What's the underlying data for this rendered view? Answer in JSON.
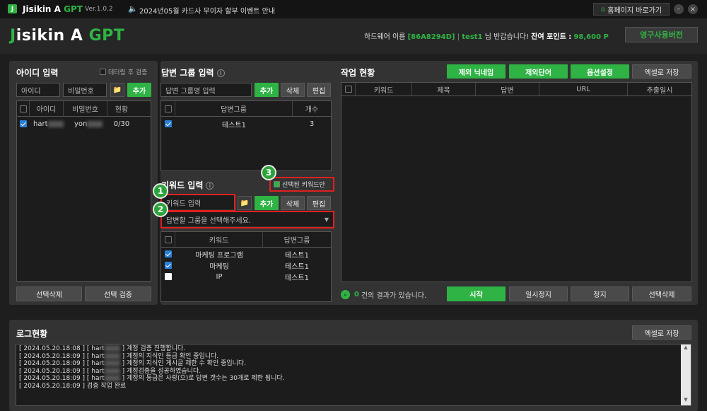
{
  "titlebar": {
    "app_name": "Jisikin A",
    "app_gpt": "GPT",
    "version": "Ver.1.0.2",
    "notice": "2024년05월 카드사 무이자 할부 이벤트 안내",
    "homepage_btn": "홈페이지 바로가기",
    "minimize": "–",
    "close": "×"
  },
  "header": {
    "logo_j": "J",
    "logo_rest": "isikin A",
    "logo_gpt": "GPT",
    "hw_label": "하드웨어 이름",
    "hw_id": "[86A8294D]",
    "user": "test1",
    "greeting": "님 반갑습니다!",
    "points_label": "잔여 포인트 :",
    "points_value": "98,600 P",
    "license_btn": "영구사용버전"
  },
  "id_panel": {
    "title": "아이디 입력",
    "after_verify_label": "데터링 후 검증",
    "id_placeholder": "아이디",
    "pw_placeholder": "비밀번호",
    "add_btn": "추가",
    "columns": [
      "",
      "아이디",
      "비밀번호",
      "현황"
    ],
    "rows": [
      {
        "checked": true,
        "id": "hart",
        "pw": "yon",
        "status": "0/30"
      }
    ],
    "delete_btn": "선택삭제",
    "verify_btn": "선택 검증"
  },
  "group_panel": {
    "title": "답변 그룹 입력",
    "input_placeholder": "답변 그룹명 입력",
    "add_btn": "추가",
    "delete_btn": "삭제",
    "edit_btn": "편집",
    "columns": [
      "",
      "답변그룹",
      "개수"
    ],
    "rows": [
      {
        "checked": true,
        "group": "테스트1",
        "count": "3"
      }
    ]
  },
  "keyword_panel": {
    "title": "키워드 입력",
    "only_selected_label": "선택된 키워드만",
    "input_placeholder": "키워드 입력",
    "add_btn": "추가",
    "delete_btn": "삭제",
    "edit_btn": "편집",
    "select_placeholder": "답변할 그룹을 선택해주세요.",
    "columns": [
      "",
      "키워드",
      "답변그룹"
    ],
    "rows": [
      {
        "checked": true,
        "keyword": "마케팅 프로그램",
        "group": "테스트1"
      },
      {
        "checked": true,
        "keyword": "마케팅",
        "group": "테스트1"
      },
      {
        "checked": false,
        "keyword": "IP",
        "group": "테스트1"
      }
    ]
  },
  "badges": {
    "b1": "1",
    "b2": "2",
    "b3": "3"
  },
  "work_panel": {
    "title": "작업 현황",
    "exclude_nick_btn": "제외 닉네임",
    "exclude_word_btn": "제외단어",
    "options_btn": "옵션설정",
    "excel_btn": "엑셀로 저장",
    "columns": [
      "",
      "키워드",
      "제목",
      "답변",
      "URL",
      "추출일시"
    ],
    "result_count": "0",
    "result_text": "건의 결과가 있습니다.",
    "start_btn": "시작",
    "pause_btn": "일시정지",
    "stop_btn": "정지",
    "delete_btn": "선택삭제"
  },
  "log_panel": {
    "title": "로그현황",
    "excel_btn": "엑셀로 저장",
    "lines": [
      {
        "ts": "[ 2024.05.20.18:08 ] [ hart",
        "msg": "] 계정 검증 진행합니다."
      },
      {
        "ts": "[ 2024.05.20.18:09 ] [ hart",
        "msg": "] 계정의 지식인 등급 확인 중입니다."
      },
      {
        "ts": "[ 2024.05.20.18:09 ] [ hart",
        "msg": "] 계정의 지식인 게시글 제한 수 확인 중입니다."
      },
      {
        "ts": "[ 2024.05.20.18:09 ] [ hart",
        "msg": "] 계정검증을 성공하였습니다."
      },
      {
        "ts": "[ 2024.05.20.18:09 ] [ hart",
        "msg": "] 계정의 등급은 사랑(으)로 답변 갯수는 30개로 제한 됩니다."
      },
      {
        "ts": "[ 2024.05.20.18:09 ] 검증 작업 완료",
        "msg": ""
      }
    ]
  },
  "colors": {
    "accent_green": "#2fb344",
    "highlight_red": "#e02020",
    "check_blue": "#2a7fd8"
  }
}
